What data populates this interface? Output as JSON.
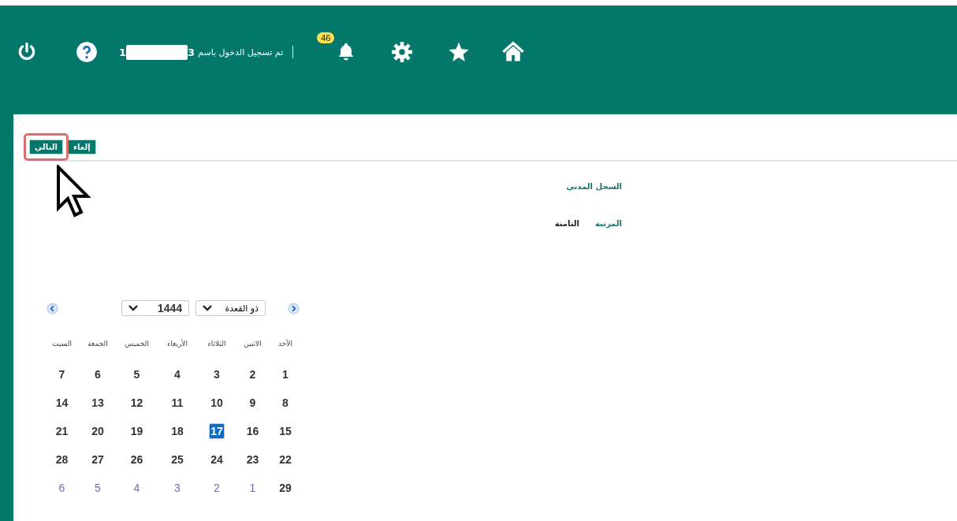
{
  "header": {
    "notifications": {
      "count": "46"
    },
    "login": {
      "label": "تم تسجيل الدخول باسم",
      "user_start": "3",
      "user_end": "1"
    }
  },
  "actions": [
    {
      "label": "إلغاء",
      "highlighted": false
    },
    {
      "label": "التالي",
      "highlighted": true
    }
  ],
  "fields": [
    {
      "label": "السجل المدني"
    },
    {
      "label": "المرتبة",
      "value": "الثامنة"
    }
  ],
  "calendar": {
    "month": "ذو القعدة",
    "year": "1444",
    "weekdays": [
      "الأحد",
      "الاثنين",
      "الثلاثاء",
      "الأربعاء",
      "الخميس",
      "الجمعة",
      "السبت"
    ],
    "days": [
      {
        "label": "1",
        "selected": false,
        "outside": false
      },
      {
        "label": "2",
        "selected": false,
        "outside": false
      },
      {
        "label": "3",
        "selected": false,
        "outside": false
      },
      {
        "label": "4",
        "selected": false,
        "outside": false
      },
      {
        "label": "5",
        "selected": false,
        "outside": false
      },
      {
        "label": "6",
        "selected": false,
        "outside": false
      },
      {
        "label": "7",
        "selected": false,
        "outside": false
      },
      {
        "label": "8",
        "selected": false,
        "outside": false
      },
      {
        "label": "9",
        "selected": false,
        "outside": false
      },
      {
        "label": "10",
        "selected": false,
        "outside": false
      },
      {
        "label": "11",
        "selected": false,
        "outside": false
      },
      {
        "label": "12",
        "selected": false,
        "outside": false
      },
      {
        "label": "13",
        "selected": false,
        "outside": false
      },
      {
        "label": "14",
        "selected": false,
        "outside": false
      },
      {
        "label": "15",
        "selected": false,
        "outside": false
      },
      {
        "label": "16",
        "selected": false,
        "outside": false
      },
      {
        "label": "17",
        "selected": true,
        "outside": false
      },
      {
        "label": "18",
        "selected": false,
        "outside": false
      },
      {
        "label": "19",
        "selected": false,
        "outside": false
      },
      {
        "label": "20",
        "selected": false,
        "outside": false
      },
      {
        "label": "21",
        "selected": false,
        "outside": false
      },
      {
        "label": "22",
        "selected": false,
        "outside": false
      },
      {
        "label": "23",
        "selected": false,
        "outside": false
      },
      {
        "label": "24",
        "selected": false,
        "outside": false
      },
      {
        "label": "25",
        "selected": false,
        "outside": false
      },
      {
        "label": "26",
        "selected": false,
        "outside": false
      },
      {
        "label": "27",
        "selected": false,
        "outside": false
      },
      {
        "label": "28",
        "selected": false,
        "outside": false
      },
      {
        "label": "29",
        "selected": false,
        "outside": false
      },
      {
        "label": "1",
        "selected": false,
        "outside": true
      },
      {
        "label": "2",
        "selected": false,
        "outside": true
      },
      {
        "label": "3",
        "selected": false,
        "outside": true
      },
      {
        "label": "4",
        "selected": false,
        "outside": true
      },
      {
        "label": "5",
        "selected": false,
        "outside": true
      },
      {
        "label": "6",
        "selected": false,
        "outside": true
      }
    ]
  }
}
